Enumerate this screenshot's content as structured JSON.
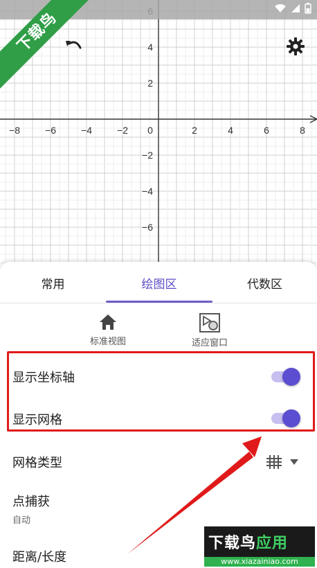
{
  "status_bar": {
    "icons": [
      "wifi-icon",
      "signal-icon",
      "battery-icon"
    ]
  },
  "corner_banner": {
    "text": "下载鸟"
  },
  "graph": {
    "x_ticks": [
      "−8",
      "−6",
      "−4",
      "−2",
      "0",
      "2",
      "4",
      "6",
      "8"
    ],
    "y_ticks": [
      "6",
      "4",
      "2",
      "−2",
      "−4",
      "−6"
    ],
    "x_tick_values": [
      -8,
      -6,
      -4,
      -2,
      0,
      2,
      4,
      6,
      8
    ],
    "y_tick_values": [
      6,
      4,
      2,
      -2,
      -4,
      -6
    ],
    "xlim": [
      -8.8,
      9.0
    ],
    "ylim": [
      -7.6,
      6.7
    ]
  },
  "toolbar": {
    "undo_icon": "undo-icon",
    "settings_icon": "gear-icon"
  },
  "tabs": [
    {
      "label": "常用"
    },
    {
      "label": "绘图区"
    },
    {
      "label": "代数区"
    }
  ],
  "quick_actions": [
    {
      "label": "标准视图",
      "icon": "home-icon"
    },
    {
      "label": "适应窗口",
      "icon": "fit-window-icon"
    }
  ],
  "settings": {
    "show_axes": {
      "label": "显示坐标轴",
      "on": true
    },
    "show_grid": {
      "label": "显示网格",
      "on": true
    },
    "grid_type": {
      "label": "网格类型",
      "icon": "grid-icon"
    },
    "point_capture": {
      "label": "点捕获",
      "value": "自动"
    },
    "distance": {
      "label": "距离/长度"
    }
  },
  "watermark": {
    "main_white": "下载鸟",
    "main_green": "应用",
    "sub": "www.xiazainiao.com"
  },
  "colors": {
    "accent": "#5c4ed0",
    "highlight": "#e01a1a",
    "banner": "#2f9e46"
  }
}
